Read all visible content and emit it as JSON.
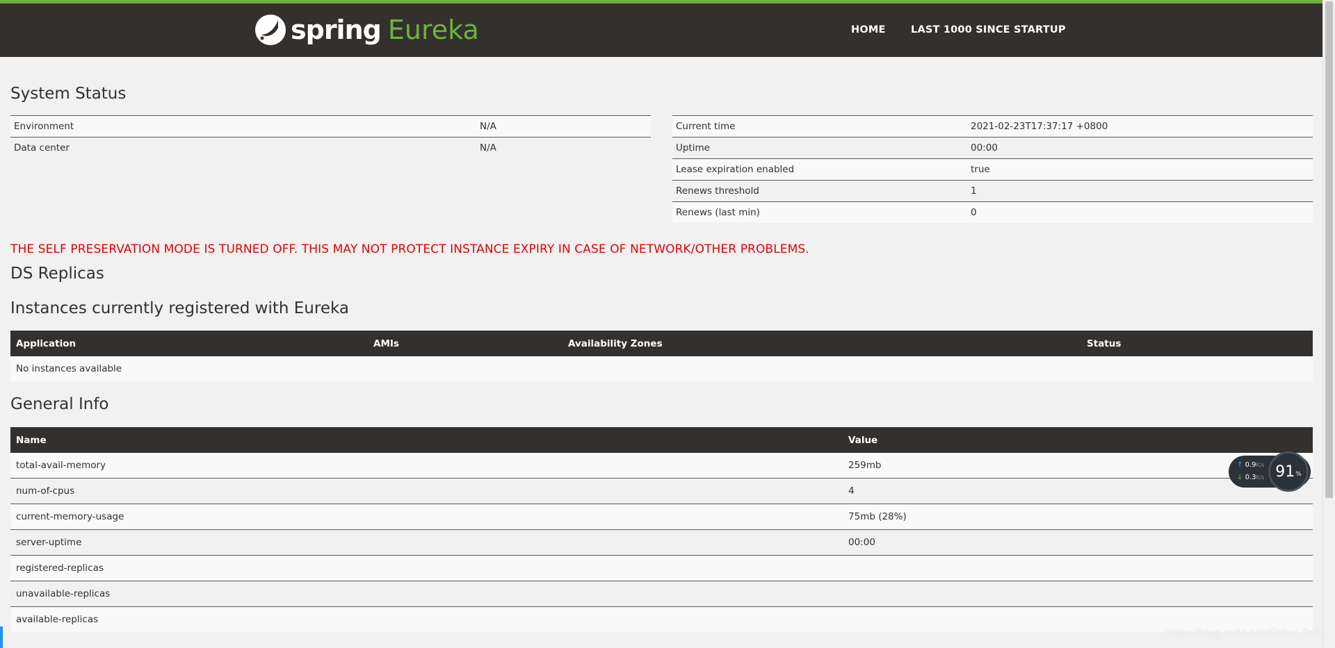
{
  "nav": {
    "brand_spring": "spring",
    "brand_eureka": "Eureka",
    "home": "HOME",
    "last1000": "LAST 1000 SINCE STARTUP"
  },
  "system_status": {
    "title": "System Status",
    "left": [
      {
        "label": "Environment",
        "value": "N/A"
      },
      {
        "label": "Data center",
        "value": "N/A"
      }
    ],
    "right": [
      {
        "label": "Current time",
        "value": "2021-02-23T17:37:17 +0800"
      },
      {
        "label": "Uptime",
        "value": "00:00"
      },
      {
        "label": "Lease expiration enabled",
        "value": "true"
      },
      {
        "label": "Renews threshold",
        "value": "1"
      },
      {
        "label": "Renews (last min)",
        "value": "0"
      }
    ]
  },
  "warning": "THE SELF PRESERVATION MODE IS TURNED OFF. THIS MAY NOT PROTECT INSTANCE EXPIRY IN CASE OF NETWORK/OTHER PROBLEMS.",
  "ds_replicas": {
    "title": "DS Replicas"
  },
  "instances": {
    "title": "Instances currently registered with Eureka",
    "headers": [
      "Application",
      "AMIs",
      "Availability Zones",
      "Status"
    ],
    "empty_text": "No instances available"
  },
  "general_info": {
    "title": "General Info",
    "headers": [
      "Name",
      "Value"
    ],
    "rows": [
      {
        "name": "total-avail-memory",
        "value": "259mb"
      },
      {
        "name": "num-of-cpus",
        "value": "4"
      },
      {
        "name": "current-memory-usage",
        "value": "75mb (28%)"
      },
      {
        "name": "server-uptime",
        "value": "00:00"
      },
      {
        "name": "registered-replicas",
        "value": ""
      },
      {
        "name": "unavailable-replicas",
        "value": ""
      },
      {
        "name": "available-replicas",
        "value": ""
      }
    ]
  },
  "net_widget": {
    "up": "0.9",
    "down": "0.3",
    "unit": "K/s",
    "percent": "91",
    "percent_unit": "%"
  },
  "watermark": "https://blog.csdn.net/Strive_Peter",
  "colors": {
    "accent": "#6db33f",
    "dark": "#34302d",
    "warning": "#e80000"
  }
}
